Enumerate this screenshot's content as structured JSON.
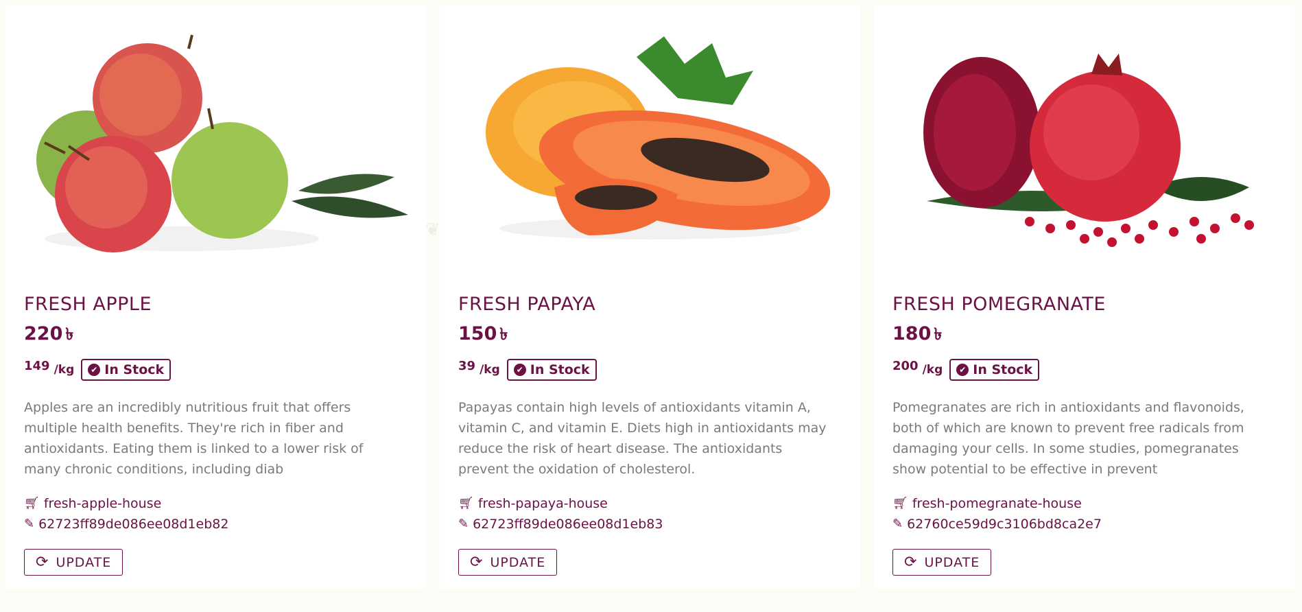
{
  "colors": {
    "accent": "#6b1245",
    "text_muted": "#7a7a7a",
    "background": "#fdfdf8"
  },
  "currency_symbol": "৳",
  "unit_label": "/kg",
  "stock_label": "In Stock",
  "update_label": "UPDATE",
  "icons": {
    "cart": "shopping-cart-icon",
    "edit": "edit-icon",
    "stock": "check-circle-icon",
    "update": "sync-icon"
  },
  "products": [
    {
      "name": "FRESH APPLE",
      "price": "220",
      "quantity": "149",
      "description": "Apples are an incredibly nutritious fruit that offers multiple health benefits. They're rich in fiber and antioxidants. Eating them is linked to a lower risk of many chronic conditions, including diab",
      "supplier": "fresh-apple-house",
      "id": "62723ff89de086ee08d1eb82"
    },
    {
      "name": "FRESH PAPAYA",
      "price": "150",
      "quantity": "39",
      "description": "Papayas contain high levels of antioxidants vitamin A, vitamin C, and vitamin E. Diets high in antioxidants may reduce the risk of heart disease. The antioxidants prevent the oxidation of cholesterol.",
      "supplier": "fresh-papaya-house",
      "id": "62723ff89de086ee08d1eb83"
    },
    {
      "name": "FRESH POMEGRANATE",
      "price": "180",
      "quantity": "200",
      "description": "Pomegranates are rich in antioxidants and flavonoids, both of which are known to prevent free radicals from damaging your cells. In some studies, pomegranates show potential to be effective in prevent",
      "supplier": "fresh-pomegranate-house",
      "id": "62760ce59d9c3106bd8ca2e7"
    }
  ]
}
